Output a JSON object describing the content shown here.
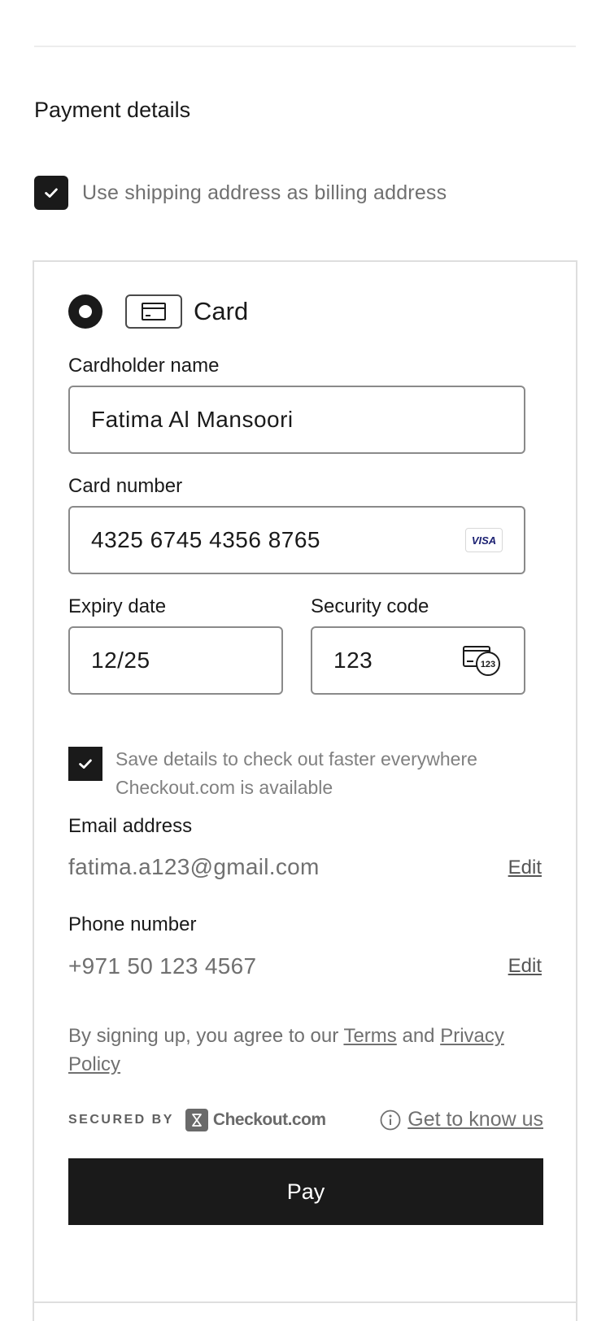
{
  "payment": {
    "section_title": "Payment details",
    "billing_same_label": "Use shipping address as billing address",
    "billing_same_checked": true
  },
  "method": {
    "label": "Card",
    "selected": true,
    "icon": "credit-card-icon"
  },
  "card": {
    "holder_label": "Cardholder name",
    "holder_value": "Fatima Al Mansoori",
    "number_label": "Card number",
    "number_value": "4325 6745 4356 8765",
    "brand": "VISA",
    "expiry_label": "Expiry date",
    "expiry_value": "12/25",
    "cvc_label": "Security code",
    "cvc_value": "123",
    "cvc_icon_text": "123"
  },
  "save": {
    "label": "Save details to check out faster everywhere Checkout.com is available",
    "checked": true
  },
  "email": {
    "label": "Email address",
    "value": "fatima.a123@gmail.com",
    "edit": "Edit"
  },
  "phone": {
    "label": "Phone number",
    "value": "+971 50 123 4567",
    "edit": "Edit"
  },
  "terms": {
    "prefix": "By signing up, you agree to our ",
    "terms_link": "Terms",
    "middle": " and ",
    "privacy_link": "Privacy Policy"
  },
  "footer": {
    "secured_by": "SECURED BY",
    "provider": "Checkout.com",
    "know_us": "Get to know us"
  },
  "pay": {
    "label": "Pay"
  },
  "colors": {
    "primary": "#1a1a1a",
    "muted_text": "#707070",
    "border": "#8a8a8a",
    "visa_blue": "#1a1f71"
  }
}
